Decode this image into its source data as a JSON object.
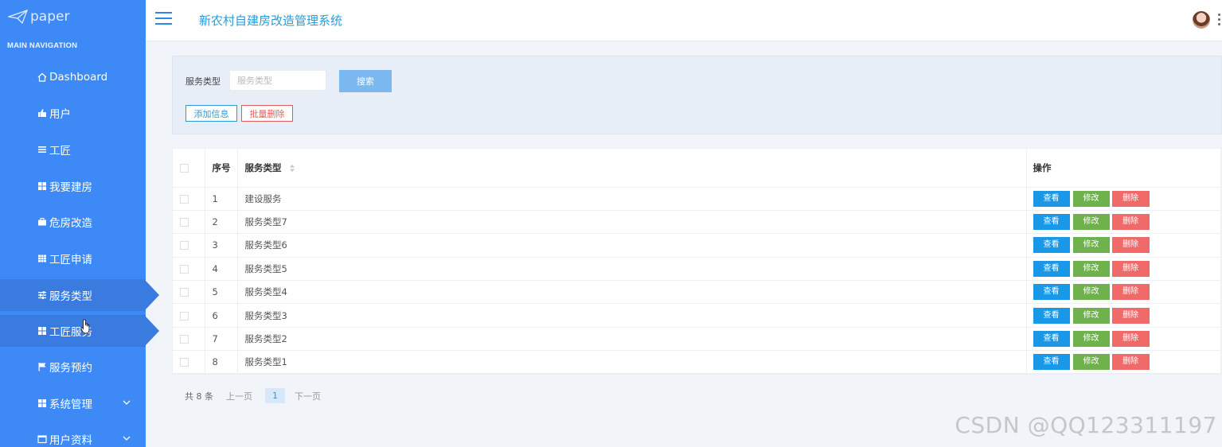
{
  "app": {
    "logo_text": "paper",
    "title": "新农村自建房改造管理系统"
  },
  "sidebar": {
    "header": "MAIN NAVIGATION",
    "items": [
      {
        "label": "Dashboard",
        "icon": "home-icon"
      },
      {
        "label": "用户",
        "icon": "thumbs-up-icon"
      },
      {
        "label": "工匠",
        "icon": "list-icon"
      },
      {
        "label": "我要建房",
        "icon": "grid-icon"
      },
      {
        "label": "危房改造",
        "icon": "briefcase-icon"
      },
      {
        "label": "工匠申请",
        "icon": "table-icon"
      },
      {
        "label": "服务类型",
        "icon": "sliders-icon"
      },
      {
        "label": "工匠服务",
        "icon": "grid-icon"
      },
      {
        "label": "服务预约",
        "icon": "flag-icon"
      },
      {
        "label": "系统管理",
        "icon": "grid-icon"
      },
      {
        "label": "用户资料",
        "icon": "id-card-icon"
      }
    ]
  },
  "search": {
    "label": "服务类型",
    "placeholder": "服务类型",
    "button": "搜索",
    "add_button": "添加信息",
    "batch_delete_button": "批量删除"
  },
  "table": {
    "headers": {
      "no": "序号",
      "type": "服务类型",
      "ops": "操作"
    },
    "rows": [
      {
        "no": "1",
        "type": "建设服务"
      },
      {
        "no": "2",
        "type": "服务类型7"
      },
      {
        "no": "3",
        "type": "服务类型6"
      },
      {
        "no": "4",
        "type": "服务类型5"
      },
      {
        "no": "5",
        "type": "服务类型4"
      },
      {
        "no": "6",
        "type": "服务类型3"
      },
      {
        "no": "7",
        "type": "服务类型2"
      },
      {
        "no": "8",
        "type": "服务类型1"
      }
    ],
    "op_labels": {
      "view": "查看",
      "edit": "修改",
      "delete": "删除"
    }
  },
  "pager": {
    "total": "共 8 条",
    "prev": "上一页",
    "current": "1",
    "next": "下一页"
  },
  "watermark": "CSDN @QQ123311197",
  "colors": {
    "sidebar": "#3d8af7",
    "accent": "#2a9bd8",
    "view": "#1a98e8",
    "edit": "#6eb14d",
    "delete": "#f06a6a"
  }
}
